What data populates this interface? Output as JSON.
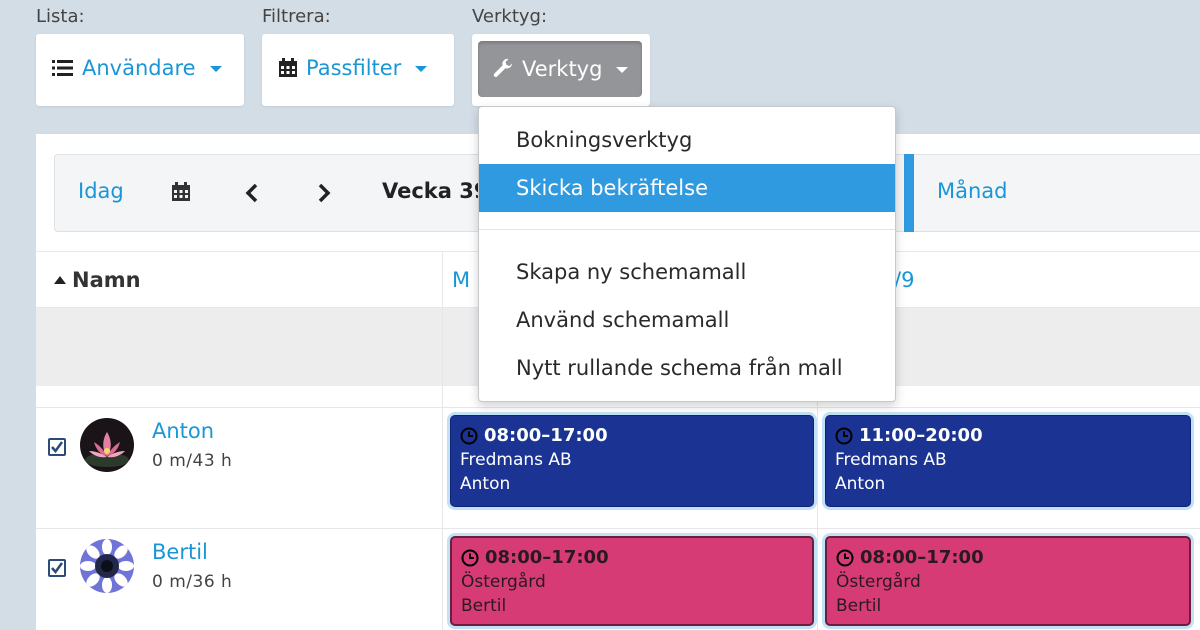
{
  "toolbar": {
    "list_label": "Lista:",
    "filter_label": "Filtrera:",
    "tools_label": "Verktyg:",
    "users_button": "Användare",
    "shiftfilter_button": "Passfilter",
    "tools_button": "Verktyg"
  },
  "nav": {
    "today": "Idag",
    "week_title": "Vecka 39",
    "month": "Månad"
  },
  "grid": {
    "name_header": "Namn",
    "day1_header": "M",
    "day2_header": "/9"
  },
  "dropdown": {
    "items": [
      "Bokningsverktyg",
      "Skicka bekräftelse",
      "Skapa ny schemamall",
      "Använd schemamall",
      "Nytt rullande schema från mall"
    ],
    "active_index": 1
  },
  "people": [
    {
      "name": "Anton",
      "hours": "0 m/43 h",
      "shifts": [
        {
          "time": "08:00–17:00",
          "company": "Fredmans AB",
          "person": "Anton"
        },
        {
          "time": "11:00–20:00",
          "company": "Fredmans AB",
          "person": "Anton"
        }
      ]
    },
    {
      "name": "Bertil",
      "hours": "0 m/36 h",
      "shifts": [
        {
          "time": "08:00–17:00",
          "company": "Östergård",
          "person": "Bertil"
        },
        {
          "time": "08:00–17:00",
          "company": "Östergård",
          "person": "Bertil"
        }
      ]
    }
  ],
  "colors": {
    "accent": "#1a96d8",
    "shift_blue": "#1b3494",
    "shift_pink": "#d63b76",
    "menu_active": "#2f9ae0"
  },
  "icons": [
    "list-icon",
    "calendar-icon",
    "wrench-icon",
    "chevron-left-icon",
    "chevron-right-icon",
    "sort-up-icon",
    "clock-icon",
    "checkbox-checked-icon"
  ]
}
